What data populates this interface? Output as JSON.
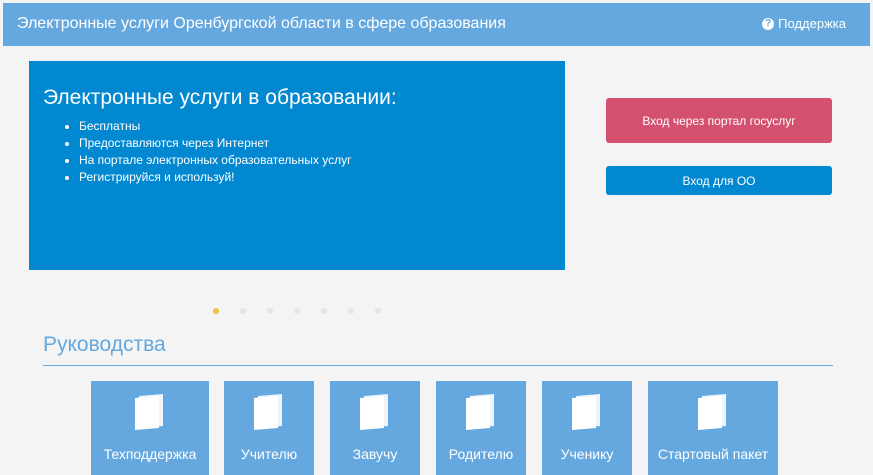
{
  "header": {
    "title": "Электронные услуги Оренбургской области в сфере образования",
    "support_label": "Поддержка"
  },
  "banner": {
    "title": "Электронные услуги в образовании:",
    "items": [
      "Бесплатны",
      "Предоставляются через Интернет",
      "На портале электронных образовательных услуг",
      "Регистрируйся и используй!"
    ]
  },
  "buttons": {
    "gosuslugi": "Вход через портал госуслуг",
    "oo": "Вход для ОО"
  },
  "carousel": {
    "count": 7,
    "active": 1
  },
  "guides": {
    "title": "Руководства",
    "tiles": [
      "Техподдержка",
      "Учителю",
      "Завучу",
      "Родителю",
      "Ученику",
      "Стартовый пакет"
    ]
  }
}
